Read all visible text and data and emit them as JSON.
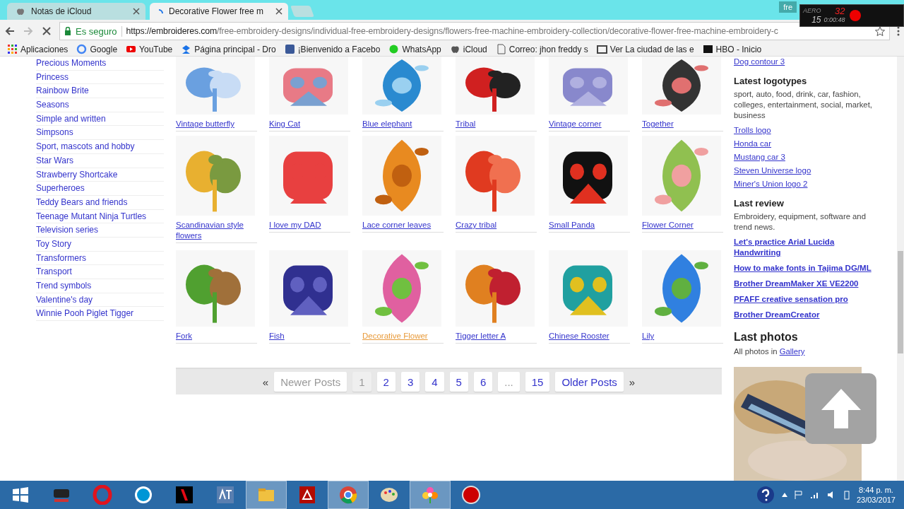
{
  "browser": {
    "tabs": [
      {
        "title": "Notas de iCloud",
        "selected": false,
        "loading": false
      },
      {
        "title": "Decorative Flower free m",
        "selected": true,
        "loading": true
      }
    ],
    "profile": "fre",
    "address": {
      "secure_label": "Es seguro",
      "host": "https://embroideres.com",
      "path": "/free-embroidery-designs/individual-free-embroidery-designs/flowers-free-machine-embroidery-collection/decorative-flower-free-machine-embroidery-c"
    },
    "bookmarks": [
      {
        "kind": "apps",
        "label": "Aplicaciones"
      },
      {
        "kind": "google",
        "label": "Google"
      },
      {
        "kind": "video",
        "label": "YouTube"
      },
      {
        "kind": "box",
        "label": "Página principal - Dro"
      },
      {
        "kind": "f",
        "label": "¡Bienvenido a Facebo"
      },
      {
        "kind": "chat",
        "label": "WhatsApp"
      },
      {
        "kind": "apple",
        "label": "iCloud"
      },
      {
        "kind": "page",
        "label": "Correo: jhon freddy s"
      },
      {
        "kind": "film",
        "label": "Ver La ciudad de las e"
      },
      {
        "kind": "tv",
        "label": "HBO - Inicio"
      }
    ]
  },
  "recorder": {
    "mode": "AERO",
    "fps_low": "15",
    "fps": "32",
    "time": "0:00:48"
  },
  "sidebar": {
    "items": [
      "Precious Moments",
      "Princess",
      "Rainbow Brite",
      "Seasons",
      "Simple and written",
      "Simpsons",
      "Sport, mascots and hobby",
      "Star Wars",
      "Strawberry Shortcake",
      "Superheroes",
      "Teddy Bears and friends",
      "Teenage Mutant Ninja Turtles",
      "Television series",
      "Toy Story",
      "Transformers",
      "Transport",
      "Trend symbols",
      "Valentine's day",
      "Winnie Pooh Piglet Tigger"
    ]
  },
  "designs": [
    {
      "title": "Vintage butterfly",
      "hovered": false,
      "kind": "picture"
    },
    {
      "title": "King Cat",
      "hovered": false,
      "kind": "picture"
    },
    {
      "title": "Blue elephant",
      "hovered": false,
      "kind": "picture"
    },
    {
      "title": "Tribal",
      "hovered": false,
      "kind": "picture"
    },
    {
      "title": "Vintage corner",
      "hovered": false,
      "kind": "picture"
    },
    {
      "title": "Together",
      "hovered": false,
      "kind": "picture"
    },
    {
      "title": "Scandinavian style flowers",
      "hovered": false,
      "kind": "picture"
    },
    {
      "title": "I love my DAD",
      "hovered": false,
      "kind": "picture"
    },
    {
      "title": "Lace corner leaves",
      "hovered": false,
      "kind": "picture"
    },
    {
      "title": "Crazy tribal",
      "hovered": false,
      "kind": "picture"
    },
    {
      "title": "Small Panda",
      "hovered": false,
      "kind": "picture"
    },
    {
      "title": "Flower Corner",
      "hovered": false,
      "kind": "picture"
    },
    {
      "title": "Fork",
      "hovered": false,
      "kind": "picture"
    },
    {
      "title": "Fish",
      "hovered": false,
      "kind": "picture"
    },
    {
      "title": "Decorative Flower",
      "hovered": true,
      "kind": "picture"
    },
    {
      "title": "Tigger letter A",
      "hovered": false,
      "kind": "picture"
    },
    {
      "title": "Chinese Rooster",
      "hovered": false,
      "kind": "picture"
    },
    {
      "title": "Lily",
      "hovered": false,
      "kind": "picture"
    }
  ],
  "pagination": [
    {
      "kind": "arrow",
      "label": "«"
    },
    {
      "kind": "page",
      "label": "Newer Posts",
      "disabled": true,
      "selected": false
    },
    {
      "kind": "page",
      "label": "1",
      "disabled": false,
      "selected": true
    },
    {
      "kind": "page",
      "label": "2",
      "disabled": false,
      "selected": false
    },
    {
      "kind": "page",
      "label": "3",
      "disabled": false,
      "selected": false
    },
    {
      "kind": "page",
      "label": "4",
      "disabled": false,
      "selected": false
    },
    {
      "kind": "page",
      "label": "5",
      "disabled": false,
      "selected": false
    },
    {
      "kind": "page",
      "label": "6",
      "disabled": false,
      "selected": false
    },
    {
      "kind": "page",
      "label": "...",
      "disabled": true,
      "selected": false
    },
    {
      "kind": "page",
      "label": "15",
      "disabled": false,
      "selected": false
    },
    {
      "kind": "page",
      "label": "Older Posts",
      "disabled": false,
      "selected": false
    },
    {
      "kind": "arrow",
      "label": "»"
    }
  ],
  "right_sidebar": {
    "top_link": "Dog contour 3",
    "sections": [
      {
        "title": "Latest logotypes",
        "text": "sport, auto, food, drink, car, fashion, colleges, entertainment, social, market, business",
        "links": [
          "Trolls logo",
          "Honda car",
          "Mustang car 3",
          "Steven Universe logo",
          "Miner's Union logo 2"
        ],
        "bold_links": false
      },
      {
        "title": "Last review",
        "text": "Embroidery, equipment, software and trend news.",
        "links": [
          "Let's practice Arial Lucida Handwriting",
          "How to make fonts in Tajima DG/ML",
          "Brother DreamMaker XE VE2200",
          "PFAFF creative sensation pro",
          "Brother DreamCreator"
        ],
        "bold_links": true
      }
    ],
    "photos": {
      "title": "Last photos",
      "text": "All photos in ",
      "link": "Gallery",
      "kind": "picture"
    }
  },
  "taskbar": {
    "apps": [
      {
        "kind": "game",
        "active": false
      },
      {
        "kind": "ring",
        "active": false
      },
      {
        "kind": "round",
        "active": false
      },
      {
        "kind": "tile",
        "active": false
      },
      {
        "kind": "lang",
        "active": false
      },
      {
        "kind": "folder",
        "active": true
      },
      {
        "kind": "pdf",
        "active": false
      },
      {
        "kind": "browser",
        "active": true
      },
      {
        "kind": "palette",
        "active": false
      },
      {
        "kind": "flower",
        "active": true
      },
      {
        "kind": "record",
        "active": false
      }
    ],
    "time": "8:44 p. m.",
    "date": "23/03/2017"
  }
}
